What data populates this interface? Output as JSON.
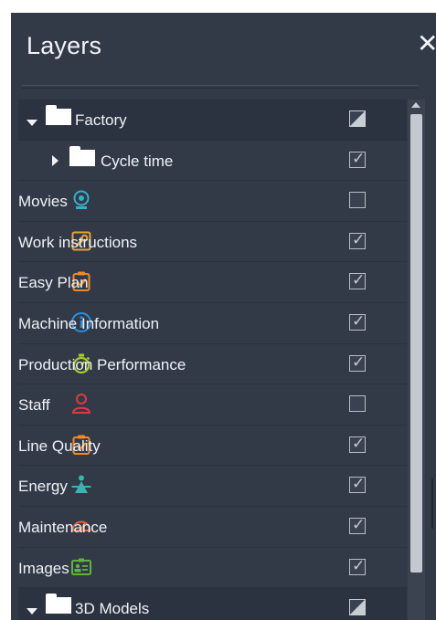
{
  "panel": {
    "title": "Layers",
    "close_glyph": "✕"
  },
  "layers": [
    {
      "label": "Factory",
      "kind": "group",
      "icon": "folder-icon",
      "state": "partial",
      "expanded": true
    },
    {
      "label": "Cycle time",
      "kind": "subgroup",
      "icon": "folder-icon",
      "state": "checked",
      "expanded": false
    },
    {
      "label": "Movies",
      "kind": "item",
      "icon": "webcam-icon",
      "color": "#33b0c7",
      "state": "unchecked"
    },
    {
      "label": "Work instructions",
      "kind": "item",
      "icon": "wrench-icon",
      "color": "#e6a23c",
      "state": "checked"
    },
    {
      "label": "Easy Plan",
      "kind": "item",
      "icon": "clipboard-check-icon",
      "color": "#f08a24",
      "state": "checked"
    },
    {
      "label": "Machine Information",
      "kind": "item",
      "icon": "info-icon",
      "color": "#2b8fe0",
      "state": "checked"
    },
    {
      "label": "Production Performance",
      "kind": "item",
      "icon": "stopwatch-icon",
      "color": "#a6cf2a",
      "state": "checked"
    },
    {
      "label": "Staff",
      "kind": "item",
      "icon": "person-icon",
      "color": "#e0393e",
      "state": "unchecked"
    },
    {
      "label": "Line Quality",
      "kind": "item",
      "icon": "clipboard-check-icon",
      "color": "#f08a24",
      "state": "checked"
    },
    {
      "label": "Energy",
      "kind": "item",
      "icon": "energy-person-icon",
      "color": "#37b6b0",
      "state": "checked"
    },
    {
      "label": "Maintenance",
      "kind": "item",
      "icon": "gauge-icon",
      "color": "#e8643a",
      "state": "checked"
    },
    {
      "label": "Images",
      "kind": "item",
      "icon": "id-card-icon",
      "color": "#5fb43a",
      "state": "checked"
    },
    {
      "label": "3D Models",
      "kind": "group",
      "icon": "folder-icon",
      "state": "partial",
      "expanded": true
    }
  ],
  "colors": {
    "panel_bg": "#323a48",
    "group_row_bg": "#2b3240",
    "text": "#f0f2f5"
  }
}
